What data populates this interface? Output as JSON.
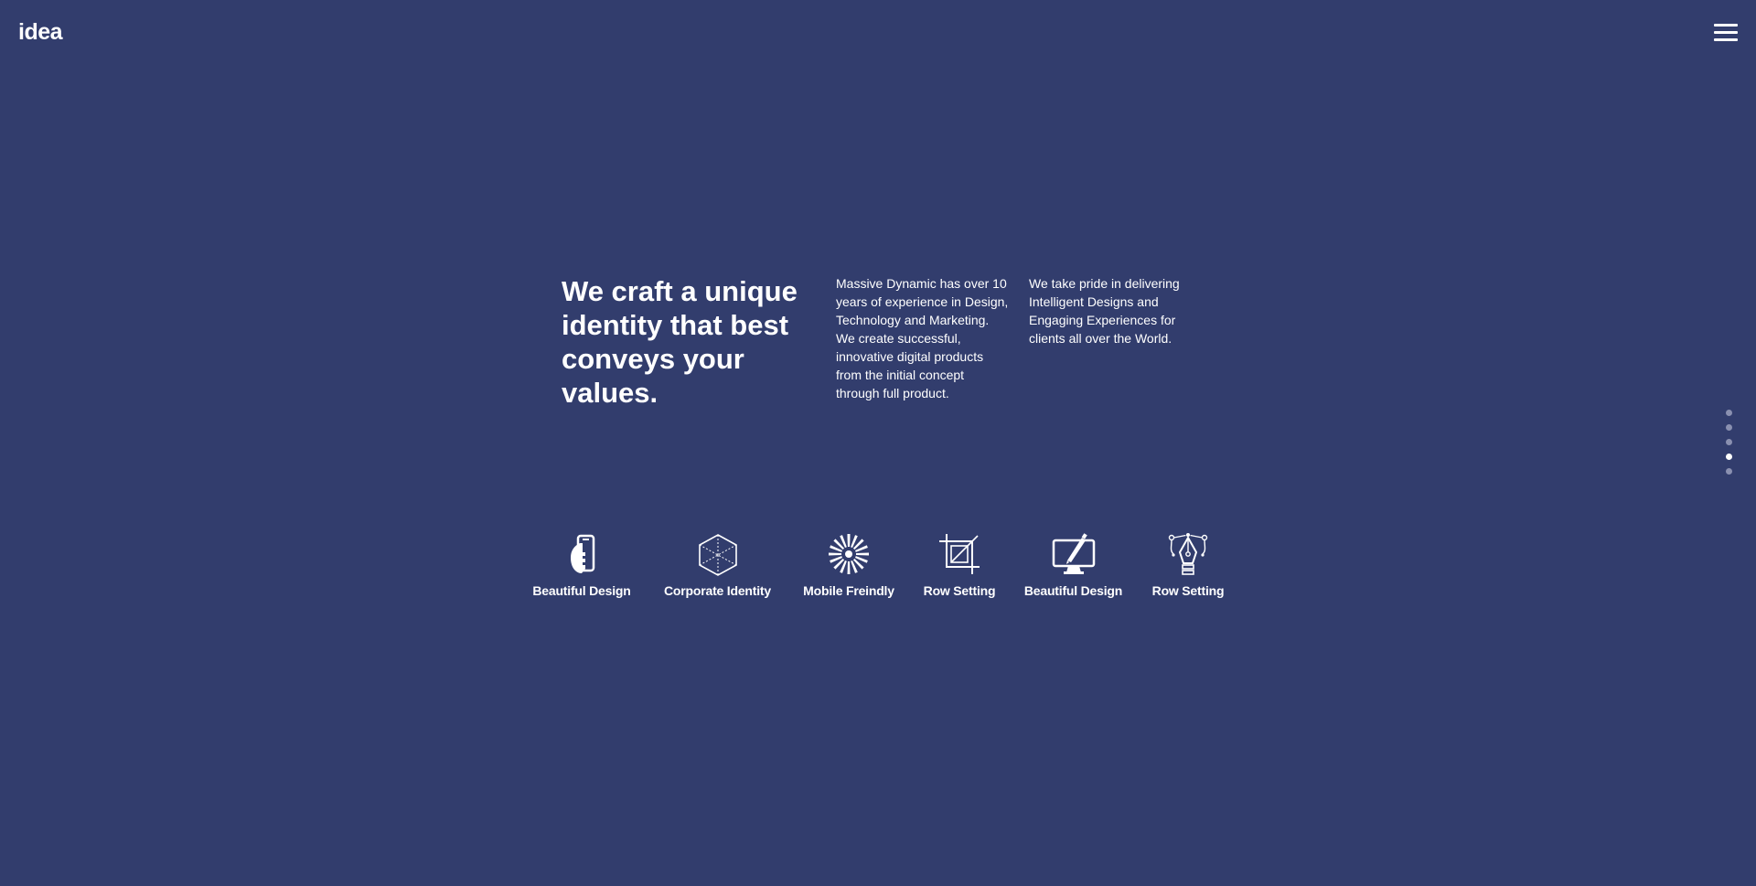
{
  "brand": {
    "logo_text": "idea"
  },
  "header": {
    "menu_icon": "hamburger-menu-icon"
  },
  "hero": {
    "headline": "We craft a unique identity that best conveys your values.",
    "paragraph_1": "Massive Dynamic has over 10 years of experience in Design, Technology and Marketing. We create successful, innovative digital products from the initial concept through full product.",
    "paragraph_2": "We take pride in delivering Intelligent Designs and Engaging Experiences for clients all over the World."
  },
  "features": [
    {
      "label": "Beautiful Design",
      "icon": "hand-phone-icon"
    },
    {
      "label": "Corporate Identity",
      "icon": "cube-icon"
    },
    {
      "label": "Mobile Freindly",
      "icon": "burst-icon"
    },
    {
      "label": "Row Setting",
      "icon": "crop-icon"
    },
    {
      "label": "Beautiful Design",
      "icon": "monitor-pen-icon"
    },
    {
      "label": "Row Setting",
      "icon": "pen-tool-icon"
    }
  ],
  "pagination": {
    "count": 5,
    "active_index": 3
  },
  "colors": {
    "background": "#323d6d",
    "text": "#ffffff",
    "inactive_dot": "#8a90b0"
  }
}
